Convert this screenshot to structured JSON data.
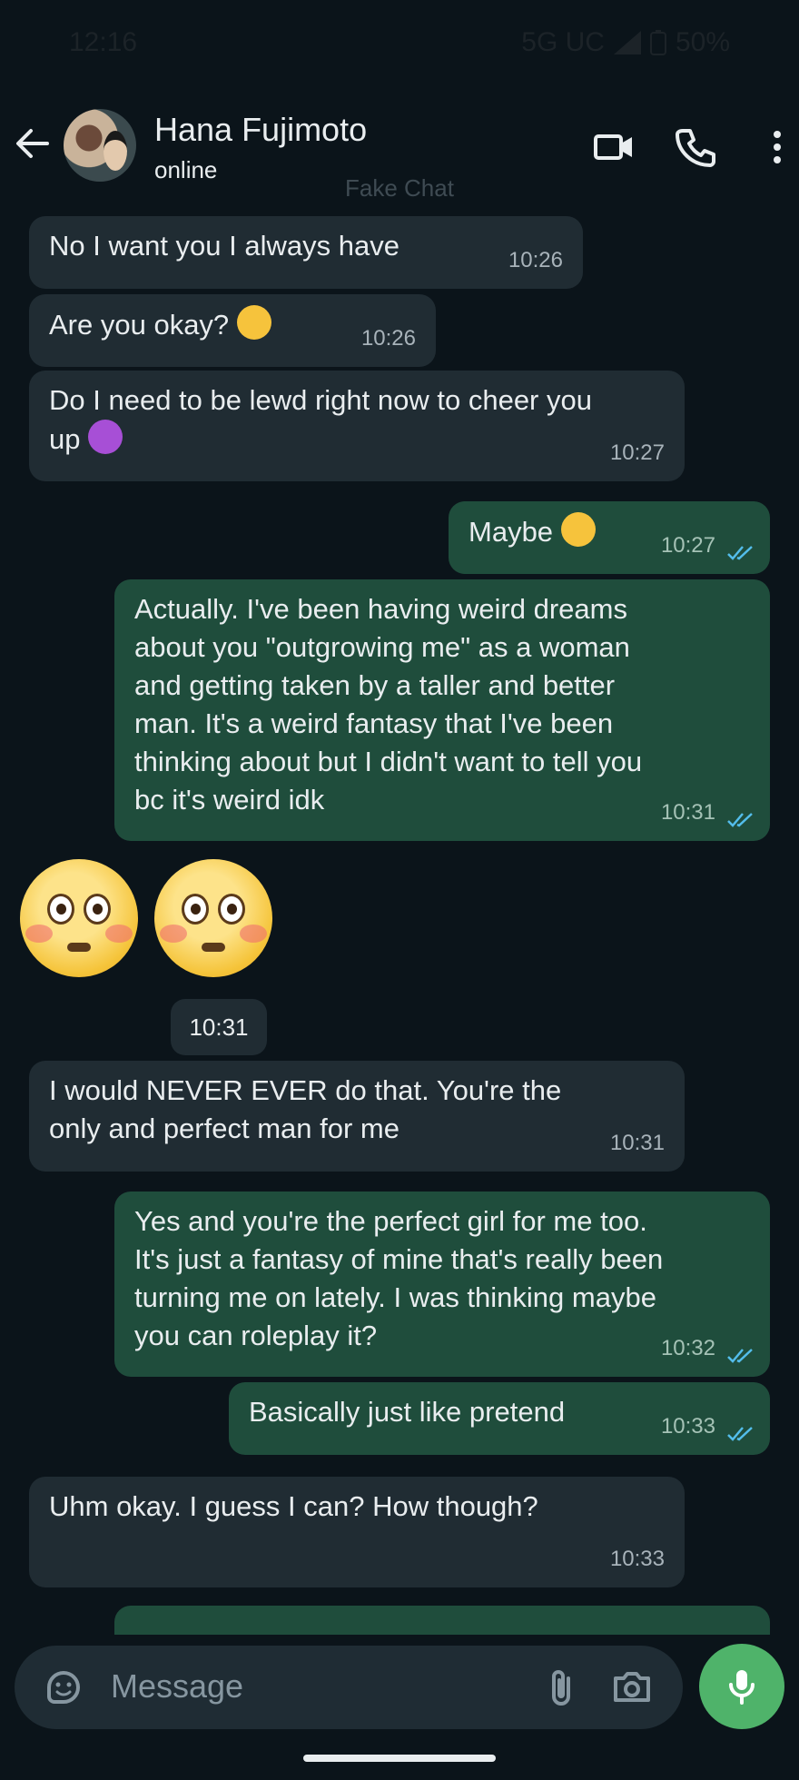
{
  "status_bar": {
    "time": "12:16",
    "network": "5G UC",
    "battery": "50%"
  },
  "header": {
    "contact_name": "Hana Fujimoto",
    "status": "online",
    "watermark": "Fake Chat"
  },
  "messages": [
    {
      "dir": "in",
      "text": "No I want you I always have",
      "time": "10:26"
    },
    {
      "dir": "in",
      "text": "Are you okay?",
      "emoji": "disappointed-face",
      "time": "10:26"
    },
    {
      "dir": "in",
      "text1": "Do I need to be lewd right now to cheer you",
      "text2": "up",
      "emoji": "smiling-devil",
      "time": "10:27"
    },
    {
      "dir": "out",
      "text": "Maybe",
      "emoji": "thinking-face",
      "time": "10:27"
    },
    {
      "dir": "out",
      "lines": [
        "Actually. I've been having weird dreams",
        "about you \"outgrowing me\" as a woman",
        "and getting taken by a taller and better",
        "man. It's a weird fantasy that I've been",
        "thinking about but I didn't want to tell you",
        "bc it's weird idk"
      ],
      "time": "10:31"
    },
    {
      "dir": "in",
      "emoji": "flushed-face",
      "count": 2,
      "time": "10:31"
    },
    {
      "dir": "in",
      "lines": [
        "I would NEVER EVER do that. You're the",
        "only and perfect man for me"
      ],
      "time": "10:31"
    },
    {
      "dir": "out",
      "lines": [
        "Yes and you're the perfect girl for me too.",
        "It's just a fantasy of mine  that's really been",
        "turning me on lately. I was thinking maybe",
        "you can roleplay it?"
      ],
      "time": "10:32"
    },
    {
      "dir": "out",
      "text": "Basically just like pretend",
      "time": "10:33"
    },
    {
      "dir": "in",
      "text": "Uhm okay. I guess I can? How though?",
      "time": "10:33"
    },
    {
      "dir": "out",
      "partial": true
    }
  ],
  "input": {
    "placeholder": "Message"
  },
  "colors": {
    "incoming": "#202c33",
    "outgoing": "#1f4d3c",
    "accent": "#4fb36a",
    "read_ticks": "#53bdeb"
  },
  "icons": [
    "back-arrow-icon",
    "video-call-icon",
    "phone-icon",
    "more-vert-icon",
    "sticker-icon",
    "attach-icon",
    "camera-icon",
    "mic-icon"
  ]
}
